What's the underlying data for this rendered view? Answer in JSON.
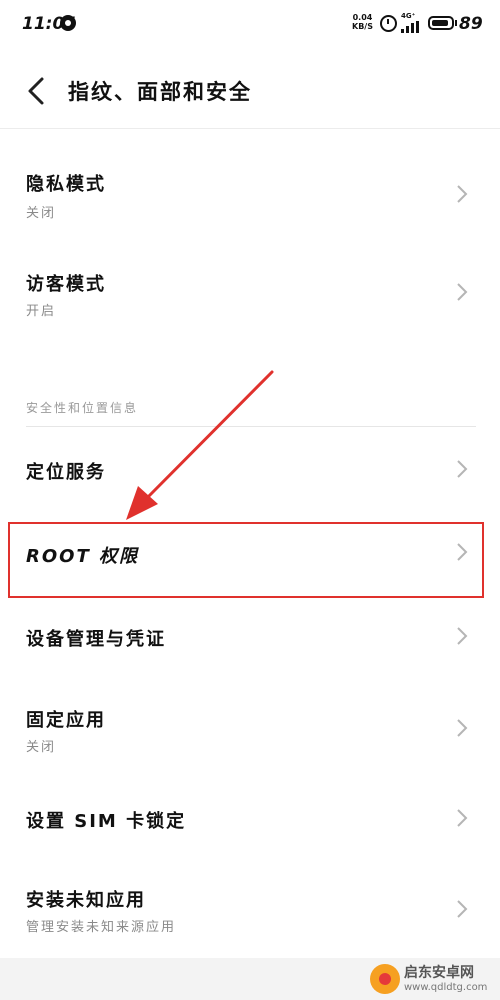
{
  "status_bar": {
    "time": "11:04",
    "net_speed_value": "0.04",
    "net_speed_unit": "KB/S",
    "network_type": "4G⁺",
    "battery_level": "89",
    "battery_fraction": 0.89
  },
  "header": {
    "title": "指纹、面部和安全"
  },
  "items": [
    {
      "title": "隐私模式",
      "subtitle": "关闭"
    },
    {
      "title": "访客模式",
      "subtitle": "开启"
    },
    {
      "title": "定位服务",
      "subtitle": ""
    },
    {
      "title": "ROOT 权限",
      "subtitle": ""
    },
    {
      "title": "设备管理与凭证",
      "subtitle": ""
    },
    {
      "title": "固定应用",
      "subtitle": "关闭"
    },
    {
      "title": "设置 SIM 卡锁定",
      "subtitle": ""
    },
    {
      "title": "安装未知应用",
      "subtitle": "管理安装未知来源应用"
    }
  ],
  "section": {
    "header": "安全性和位置信息"
  },
  "watermark": {
    "name": "启东安卓网",
    "url": "www.qdldtg.com"
  },
  "colors": {
    "highlight": "#e0312d",
    "background": "#ffffff",
    "subtitle": "#8a8a8a"
  }
}
